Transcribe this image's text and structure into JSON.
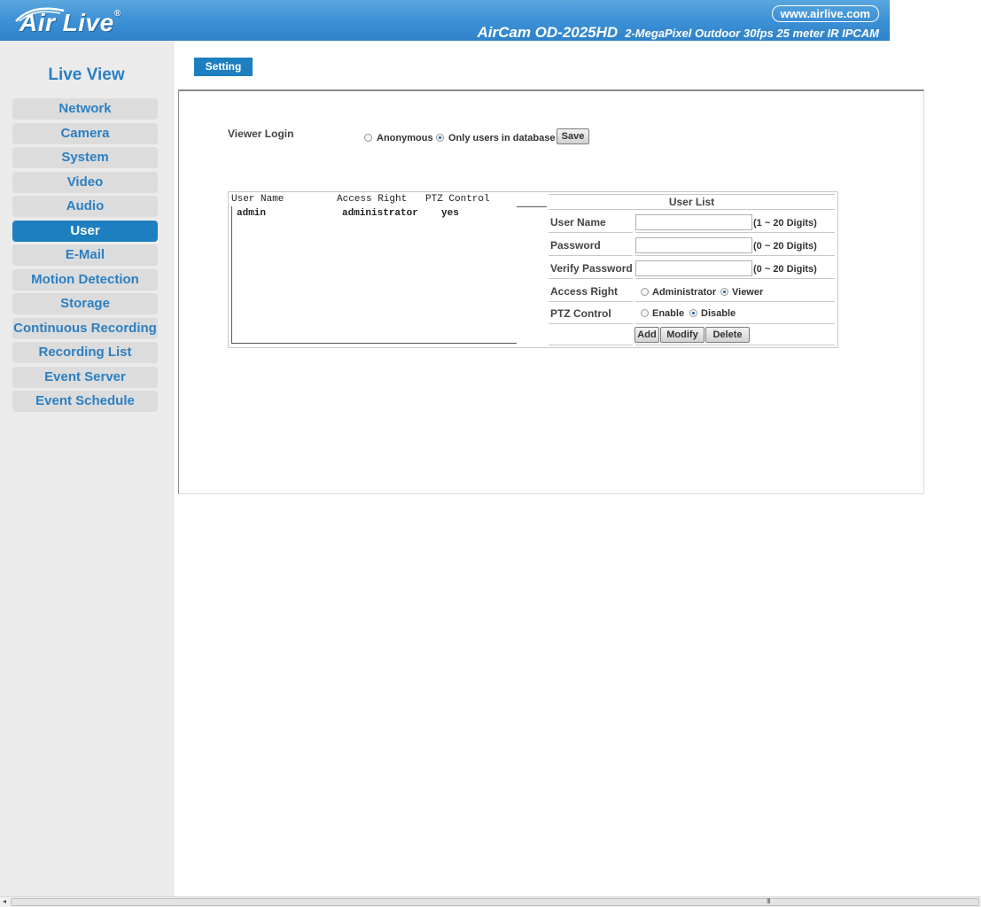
{
  "header": {
    "logo_text": "Air Live",
    "logo_reg": "®",
    "url": "www.airlive.com",
    "model": "AirCam OD-2025HD",
    "tagline": "2-MegaPixel Outdoor 30fps 25 meter IR IPCAM",
    "brand_color": "#3b8fd4"
  },
  "sidebar": {
    "title": "Live View",
    "items": [
      {
        "label": "Network"
      },
      {
        "label": "Camera"
      },
      {
        "label": "System"
      },
      {
        "label": "Video"
      },
      {
        "label": "Audio"
      },
      {
        "label": "User",
        "active": true
      },
      {
        "label": "E-Mail"
      },
      {
        "label": "Motion Detection"
      },
      {
        "label": "Storage"
      },
      {
        "label": "Continuous Recording"
      },
      {
        "label": "Recording List"
      },
      {
        "label": "Event Server"
      },
      {
        "label": "Event Schedule"
      }
    ]
  },
  "main": {
    "tab": "Setting",
    "viewer_login": {
      "label": "Viewer Login",
      "options": [
        "Anonymous",
        "Only users in database"
      ],
      "selected": "Only users in database",
      "save_label": "Save"
    },
    "user_table": {
      "columns": [
        "User Name",
        "Access Right",
        "PTZ Control"
      ],
      "rows": [
        {
          "user": "admin",
          "access": "administrator",
          "ptz": "yes"
        }
      ]
    },
    "form": {
      "title": "User List",
      "username_label": "User Name",
      "username_hint": "(1 ~ 20 Digits)",
      "username_value": "",
      "password_label": "Password",
      "password_hint": "(0 ~ 20 Digits)",
      "verify_label": "Verify Password",
      "verify_hint": "(0 ~ 20 Digits)",
      "access_label": "Access Right",
      "access_options": [
        "Administrator",
        "Viewer"
      ],
      "access_selected": "Viewer",
      "ptz_label": "PTZ Control",
      "ptz_options": [
        "Enable",
        "Disable"
      ],
      "ptz_selected": "Disable",
      "add_label": "Add",
      "modify_label": "Modify",
      "delete_label": "Delete"
    }
  },
  "scrollbar": {
    "grip": "III"
  }
}
